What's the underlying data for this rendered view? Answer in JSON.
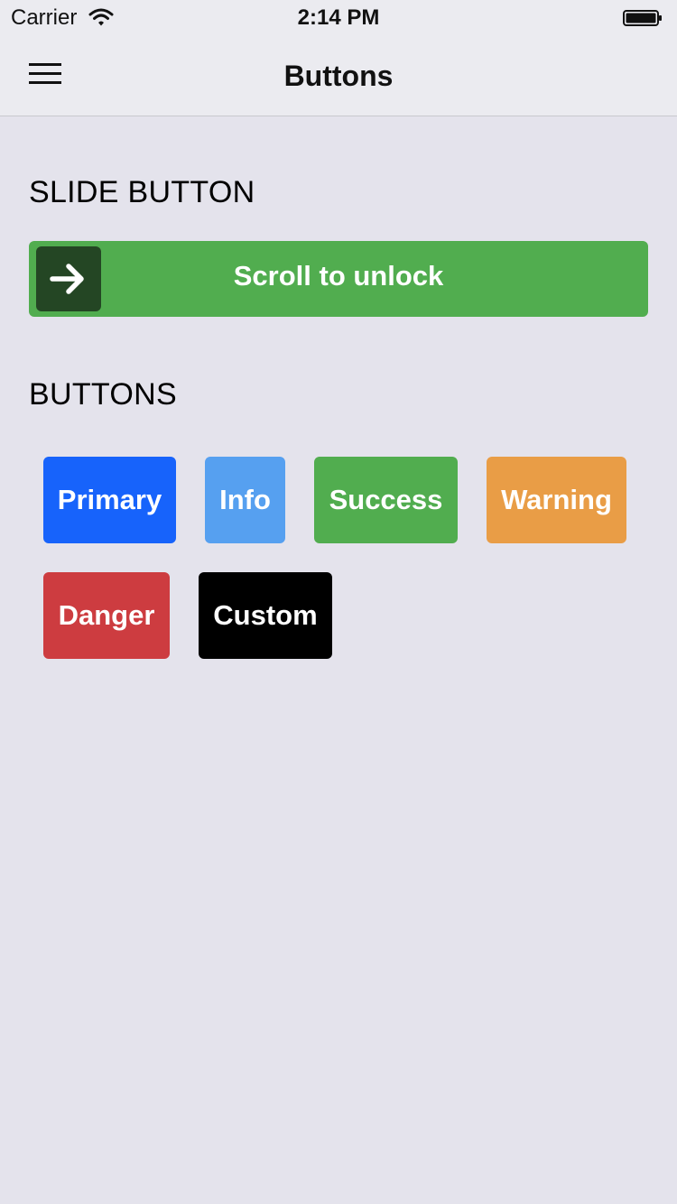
{
  "status_bar": {
    "carrier": "Carrier",
    "time": "2:14 PM",
    "wifi_icon": "wifi-icon",
    "battery_icon": "battery-icon"
  },
  "nav": {
    "title": "Buttons",
    "menu_icon": "hamburger-menu-icon"
  },
  "slide_section": {
    "title": "SLIDE BUTTON",
    "slide_label": "Scroll to unlock",
    "handle_icon": "arrow-right-icon",
    "color": "#51ad4f",
    "handle_color": "#244624"
  },
  "buttons_section": {
    "title": "BUTTONS",
    "buttons": [
      {
        "label": "Primary",
        "color": "#1763fb"
      },
      {
        "label": "Info",
        "color": "#56a0f0"
      },
      {
        "label": "Success",
        "color": "#51ad4f"
      },
      {
        "label": "Warning",
        "color": "#e99d46"
      },
      {
        "label": "Danger",
        "color": "#cd3c40"
      },
      {
        "label": "Custom",
        "color": "#000000"
      }
    ]
  }
}
